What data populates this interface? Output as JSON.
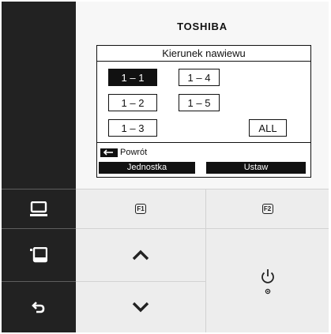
{
  "brand": "TOSHIBA",
  "lcd": {
    "title": "Kierunek nawiewu",
    "options": [
      "1 – 1",
      "1 – 2",
      "1 – 3",
      "1 – 4",
      "1 – 5",
      "ALL"
    ],
    "selected_option": "1 – 1",
    "back_label": "Powrót",
    "softkey_left": "Jednostka",
    "softkey_right": "Ustaw"
  },
  "keys": {
    "f1": "F1",
    "f2": "F2"
  },
  "icons": {
    "monitor": "monitor-icon",
    "menu": "menu-icon",
    "back": "back-arrow-icon",
    "up": "chevron-up-icon",
    "down": "chevron-down-icon",
    "power": "power-icon",
    "back_key": "return-arrow-icon"
  },
  "colors": {
    "panel_dark": "#222222",
    "body": "#ededed",
    "lcd_ink": "#111111"
  }
}
